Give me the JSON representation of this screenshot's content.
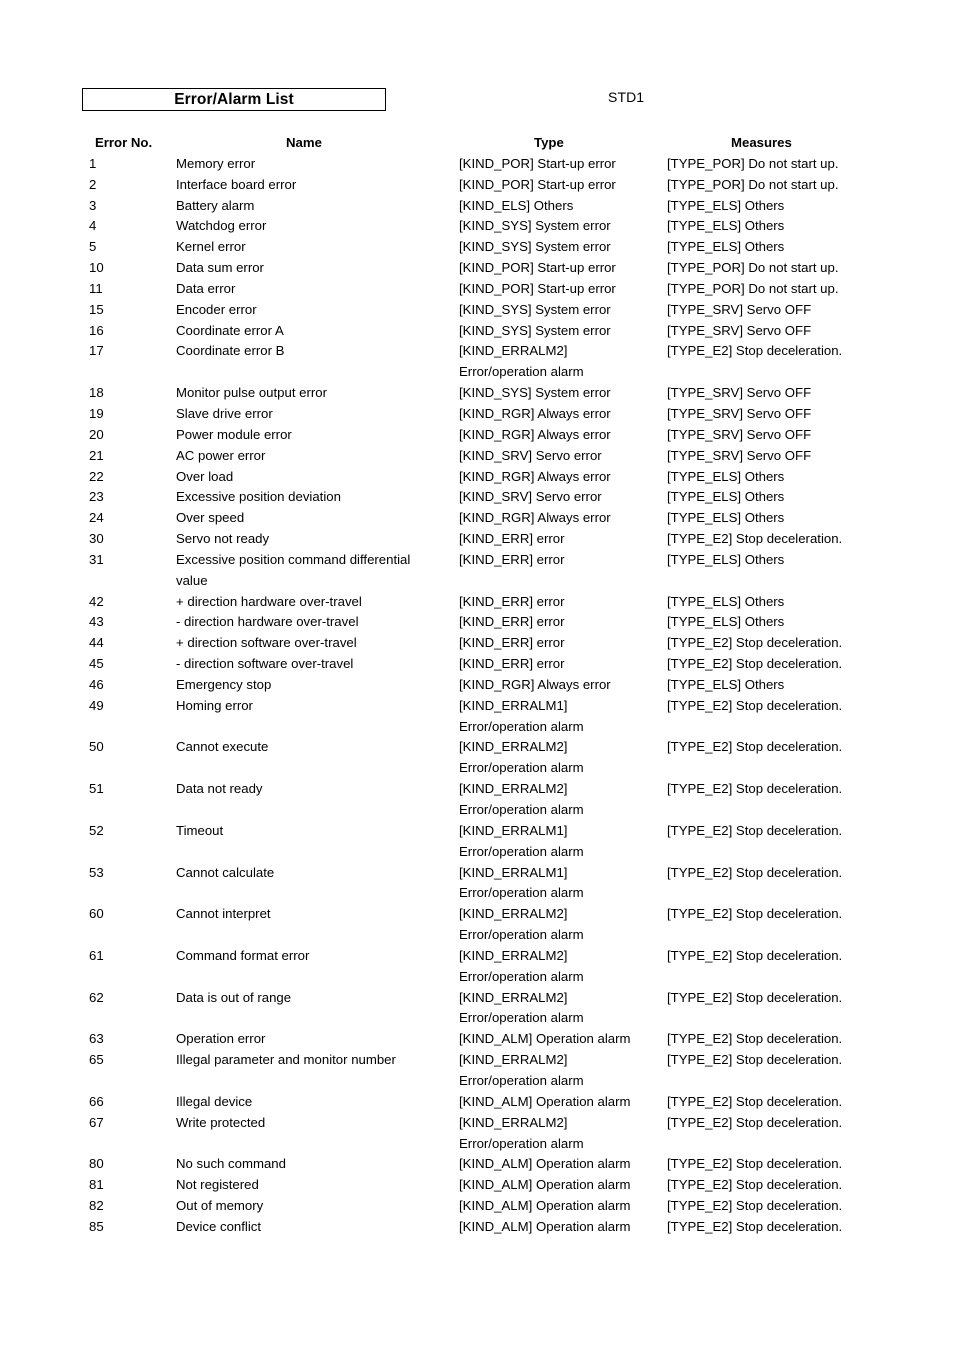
{
  "document": {
    "title": "Error/Alarm List",
    "revision_label": "STD1"
  },
  "table": {
    "headers": {
      "error_no": "Error No.",
      "name": "Name",
      "type": "Type",
      "measures": "Measures"
    },
    "rows": [
      {
        "no": "1",
        "name": "Memory error",
        "type": "[KIND_POR] Start-up error",
        "type2": "",
        "measures": "[TYPE_POR] Do not start up."
      },
      {
        "no": "2",
        "name": "Interface board error",
        "type": "[KIND_POR] Start-up error",
        "type2": "",
        "measures": "[TYPE_POR] Do not start up."
      },
      {
        "no": "3",
        "name": "Battery alarm",
        "type": "[KIND_ELS] Others",
        "type2": "",
        "measures": "[TYPE_ELS] Others"
      },
      {
        "no": "4",
        "name": "Watchdog error",
        "type": "[KIND_SYS] System error",
        "type2": "",
        "measures": "[TYPE_ELS] Others"
      },
      {
        "no": "5",
        "name": "Kernel error",
        "type": "[KIND_SYS] System error",
        "type2": "",
        "measures": "[TYPE_ELS] Others"
      },
      {
        "no": "10",
        "name": "Data sum error",
        "type": "[KIND_POR] Start-up error",
        "type2": "",
        "measures": "[TYPE_POR] Do not start up."
      },
      {
        "no": "11",
        "name": "Data error",
        "type": "[KIND_POR] Start-up error",
        "type2": "",
        "measures": "[TYPE_POR] Do not start up."
      },
      {
        "no": "15",
        "name": "Encoder error",
        "type": "[KIND_SYS] System error",
        "type2": "",
        "measures": "[TYPE_SRV] Servo OFF"
      },
      {
        "no": "16",
        "name": "Coordinate error A",
        "type": "[KIND_SYS] System error",
        "type2": "",
        "measures": "[TYPE_SRV] Servo OFF"
      },
      {
        "no": "17",
        "name": "Coordinate error B",
        "type": "[KIND_ERRALM2]",
        "type2": "Error/operation alarm",
        "measures": "[TYPE_E2] Stop deceleration."
      },
      {
        "no": "18",
        "name": "Monitor pulse output error",
        "type": "[KIND_SYS] System error",
        "type2": "",
        "measures": "[TYPE_SRV] Servo OFF"
      },
      {
        "no": "19",
        "name": "Slave drive error",
        "type": "[KIND_RGR] Always error",
        "type2": "",
        "measures": "[TYPE_SRV] Servo OFF"
      },
      {
        "no": "20",
        "name": "Power module error",
        "type": "[KIND_RGR] Always error",
        "type2": "",
        "measures": "[TYPE_SRV] Servo OFF"
      },
      {
        "no": "21",
        "name": "AC power error",
        "type": "[KIND_SRV] Servo error",
        "type2": "",
        "measures": "[TYPE_SRV] Servo OFF"
      },
      {
        "no": "22",
        "name": "Over load",
        "type": "[KIND_RGR] Always error",
        "type2": "",
        "measures": "[TYPE_ELS] Others"
      },
      {
        "no": "23",
        "name": "Excessive position deviation",
        "type": "[KIND_SRV] Servo error",
        "type2": "",
        "measures": "[TYPE_ELS] Others"
      },
      {
        "no": "24",
        "name": "Over speed",
        "type": "[KIND_RGR] Always error",
        "type2": "",
        "measures": "[TYPE_ELS] Others"
      },
      {
        "no": "30",
        "name": "Servo not ready",
        "type": "[KIND_ERR] error",
        "type2": "",
        "measures": "[TYPE_E2] Stop deceleration."
      },
      {
        "no": "31",
        "name": "Excessive position command differential",
        "name2": "value",
        "type": "[KIND_ERR] error",
        "type2": "",
        "measures": "[TYPE_ELS] Others"
      },
      {
        "no": "42",
        "name": "+ direction hardware over-travel",
        "type": "[KIND_ERR] error",
        "type2": "",
        "measures": "[TYPE_ELS] Others"
      },
      {
        "no": "43",
        "name": "- direction hardware over-travel",
        "type": "[KIND_ERR] error",
        "type2": "",
        "measures": "[TYPE_ELS] Others"
      },
      {
        "no": "44",
        "name": "+ direction software over-travel",
        "type": "[KIND_ERR] error",
        "type2": "",
        "measures": "[TYPE_E2] Stop deceleration."
      },
      {
        "no": "45",
        "name": "- direction software over-travel",
        "type": "[KIND_ERR] error",
        "type2": "",
        "measures": "[TYPE_E2] Stop deceleration."
      },
      {
        "no": "46",
        "name": "Emergency stop",
        "type": "[KIND_RGR] Always error",
        "type2": "",
        "measures": "[TYPE_ELS] Others"
      },
      {
        "no": "49",
        "name": "Homing error",
        "type": "[KIND_ERRALM1]",
        "type2": "Error/operation alarm",
        "measures": "[TYPE_E2] Stop deceleration."
      },
      {
        "no": "50",
        "name": "Cannot execute",
        "type": "[KIND_ERRALM2]",
        "type2": "Error/operation alarm",
        "measures": "[TYPE_E2] Stop deceleration."
      },
      {
        "no": "51",
        "name": "Data not ready",
        "type": "[KIND_ERRALM2]",
        "type2": "Error/operation alarm",
        "measures": "[TYPE_E2] Stop deceleration."
      },
      {
        "no": "52",
        "name": "Timeout",
        "type": "[KIND_ERRALM1]",
        "type2": "Error/operation alarm",
        "measures": "[TYPE_E2] Stop deceleration."
      },
      {
        "no": "53",
        "name": "Cannot calculate",
        "type": "[KIND_ERRALM1]",
        "type2": "Error/operation alarm",
        "measures": "[TYPE_E2] Stop deceleration."
      },
      {
        "no": "60",
        "name": "Cannot interpret",
        "type": "[KIND_ERRALM2]",
        "type2": "Error/operation alarm",
        "measures": "[TYPE_E2] Stop deceleration."
      },
      {
        "no": "61",
        "name": "Command format error",
        "type": "[KIND_ERRALM2]",
        "type2": "Error/operation alarm",
        "measures": "[TYPE_E2] Stop deceleration."
      },
      {
        "no": "62",
        "name": "Data is out of range",
        "type": "[KIND_ERRALM2]",
        "type2": "Error/operation alarm",
        "measures": "[TYPE_E2] Stop deceleration."
      },
      {
        "no": "63",
        "name": "Operation error",
        "type": "[KIND_ALM] Operation alarm",
        "type2": "",
        "measures": "[TYPE_E2] Stop deceleration."
      },
      {
        "no": "65",
        "name": "Illegal parameter and monitor number",
        "type": "[KIND_ERRALM2]",
        "type2": "Error/operation alarm",
        "measures": "[TYPE_E2] Stop deceleration."
      },
      {
        "no": "66",
        "name": "Illegal device",
        "type": "[KIND_ALM] Operation alarm",
        "type2": "",
        "measures": "[TYPE_E2] Stop deceleration."
      },
      {
        "no": "67",
        "name": "Write protected",
        "type": "[KIND_ERRALM2]",
        "type2": "Error/operation alarm",
        "measures": "[TYPE_E2] Stop deceleration."
      },
      {
        "no": "80",
        "name": "No such command",
        "type": "[KIND_ALM] Operation alarm",
        "type2": "",
        "measures": "[TYPE_E2] Stop deceleration."
      },
      {
        "no": "81",
        "name": "Not registered",
        "type": "[KIND_ALM] Operation alarm",
        "type2": "",
        "measures": "[TYPE_E2] Stop deceleration."
      },
      {
        "no": "82",
        "name": "Out of memory",
        "type": "[KIND_ALM] Operation alarm",
        "type2": "",
        "measures": "[TYPE_E2] Stop deceleration."
      },
      {
        "no": "85",
        "name": "Device conflict",
        "type": "[KIND_ALM] Operation alarm",
        "type2": "",
        "measures": "[TYPE_E2] Stop deceleration."
      }
    ]
  }
}
